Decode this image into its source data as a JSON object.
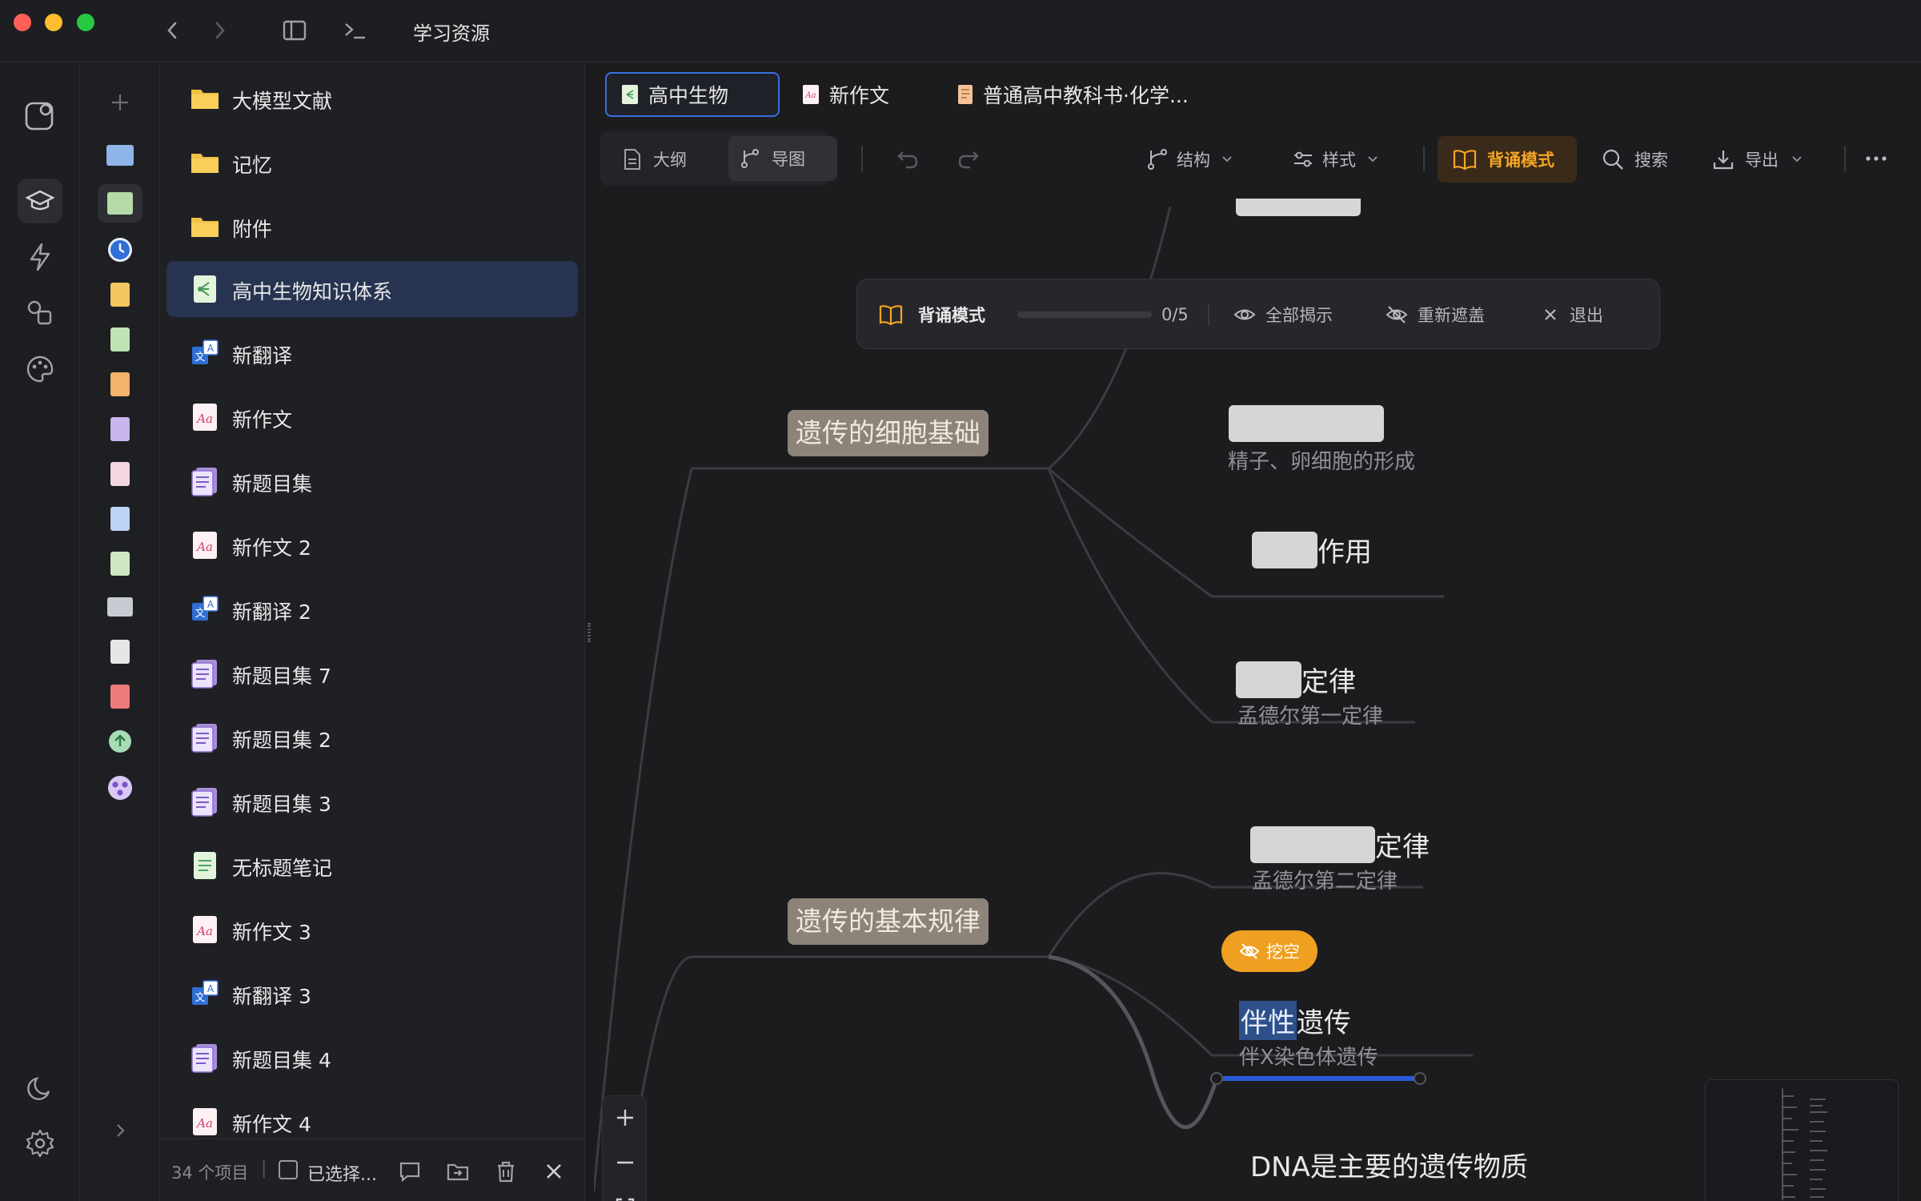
{
  "window": {
    "title": "学习资源"
  },
  "activity": {
    "items": [
      {
        "name": "app-logo-icon"
      },
      {
        "name": "graduation-cap-icon"
      },
      {
        "name": "lightning-icon"
      },
      {
        "name": "shapes-icon"
      },
      {
        "name": "palette-icon"
      }
    ],
    "bottom": [
      {
        "name": "moon-icon"
      },
      {
        "name": "gear-icon"
      }
    ]
  },
  "filelist": {
    "items": [
      {
        "label": "大模型文献",
        "type": "folder"
      },
      {
        "label": "记忆",
        "type": "folder"
      },
      {
        "label": "附件",
        "type": "folder"
      },
      {
        "label": "高中生物知识体系",
        "type": "mindmap",
        "active": true
      },
      {
        "label": "新翻译",
        "type": "translate"
      },
      {
        "label": "新作文",
        "type": "essay"
      },
      {
        "label": "新题目集",
        "type": "quiz"
      },
      {
        "label": "新作文 2",
        "type": "essay"
      },
      {
        "label": "新翻译 2",
        "type": "translate"
      },
      {
        "label": "新题目集 7",
        "type": "quiz"
      },
      {
        "label": "新题目集 2",
        "type": "quiz"
      },
      {
        "label": "新题目集 3",
        "type": "quiz"
      },
      {
        "label": "无标题笔记",
        "type": "note"
      },
      {
        "label": "新作文 3",
        "type": "essay"
      },
      {
        "label": "新翻译 3",
        "type": "translate"
      },
      {
        "label": "新题目集 4",
        "type": "quiz"
      },
      {
        "label": "新作文 4",
        "type": "essay"
      }
    ],
    "status": {
      "count": "34 个项目",
      "select": "已选择..."
    }
  },
  "tabs": [
    {
      "label": "高中生物",
      "active": true
    },
    {
      "label": "新作文"
    },
    {
      "label": "普通高中教科书·化学..."
    }
  ],
  "toolbar": {
    "outline": "大纲",
    "mindmap": "导图",
    "structure": "结构",
    "style": "样式",
    "recite": "背诵模式",
    "search": "搜索",
    "export": "导出"
  },
  "recite_panel": {
    "title": "背诵模式",
    "progress": "0/5",
    "progress_value": 0,
    "reveal_all": "全部揭示",
    "remask": "重新遮盖",
    "exit": "退出"
  },
  "mindmap": {
    "branch1": "遗传的细胞基础",
    "branch2": "遗传的基本规律",
    "leaf1_sub": "精子、卵细胞的形成",
    "leaf2_suffix": "作用",
    "leaf3_suffix": "定律",
    "leaf3_sub": "孟德尔第一定律",
    "leaf4_suffix": "定律",
    "leaf4_sub": "孟德尔第二定律",
    "dig_button": "挖空",
    "leaf5_highlight": "伴性",
    "leaf5_rest": "遗传",
    "leaf5_sub": "伴X染色体遗传",
    "next_node": "DNA是主要的遗传物质"
  },
  "colors": {
    "accent_orange": "#f0a020",
    "accent_blue": "#2a5bd7",
    "active_row": "#263451"
  }
}
